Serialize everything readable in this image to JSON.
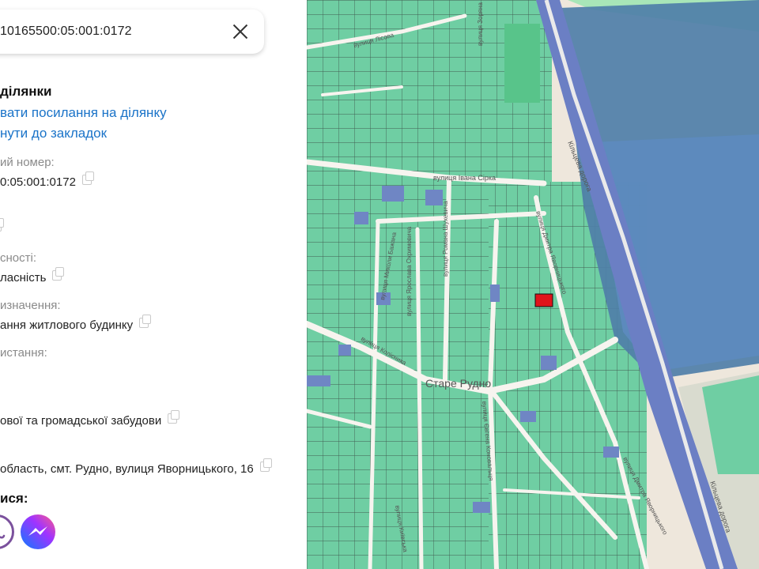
{
  "search": {
    "value": "10165500:05:001:0172"
  },
  "panel": {
    "heading": "ділянки",
    "share_link": "вати посилання на ділянку",
    "bookmark_link": "нути до закладок",
    "cad_label": "ий номер:",
    "cad_value": "0:05:001:0172",
    "owner_label": "сності:",
    "owner_value": "ласність",
    "purpose_label": "изначення:",
    "purpose_value": "ання житлового будинку",
    "use_label": "истання:",
    "use_value": "ової та громадської забудови",
    "address_value": "область, смт. Рудно, вулиця Яворницького, 16",
    "share_heading": "ися:"
  },
  "map": {
    "labels": {
      "village": "Старе Рудно",
      "ring_road_1": "Кільцева дорога",
      "ring_road_2": "Кільцева дорога",
      "street_sirka": "вулиця Івана Сірка",
      "street_yavornytskoho": "вулиця Дмитра Яворницького",
      "street_yavornytskoho_2": "вулиця Дмитра Яворницького",
      "street_shukhevycha": "вулиця Романа Шухевича",
      "street_okhrymovycha": "вулиця Ярослава Охримовича",
      "street_konovaltsia": "вулиця Євгена Коновальця",
      "street_kolisnyka": "вулиця Колісника",
      "street_mashtakova": "вулиця Миколи Бажана",
      "street_kozatska": "вулиця Зоряна",
      "street_lisova": "вулиця Лісова",
      "street_lvivska": "вулиця Київська"
    }
  },
  "colors": {
    "parcel": "#6fcea3",
    "parcel_blue": "#6f86c4",
    "water": "#4f7fa8",
    "selected": "#e0141b",
    "link": "#1a73c8",
    "road_outline": "#6b7fc4"
  },
  "icons": [
    "close-icon",
    "copy-icon",
    "viber-icon",
    "messenger-icon"
  ]
}
